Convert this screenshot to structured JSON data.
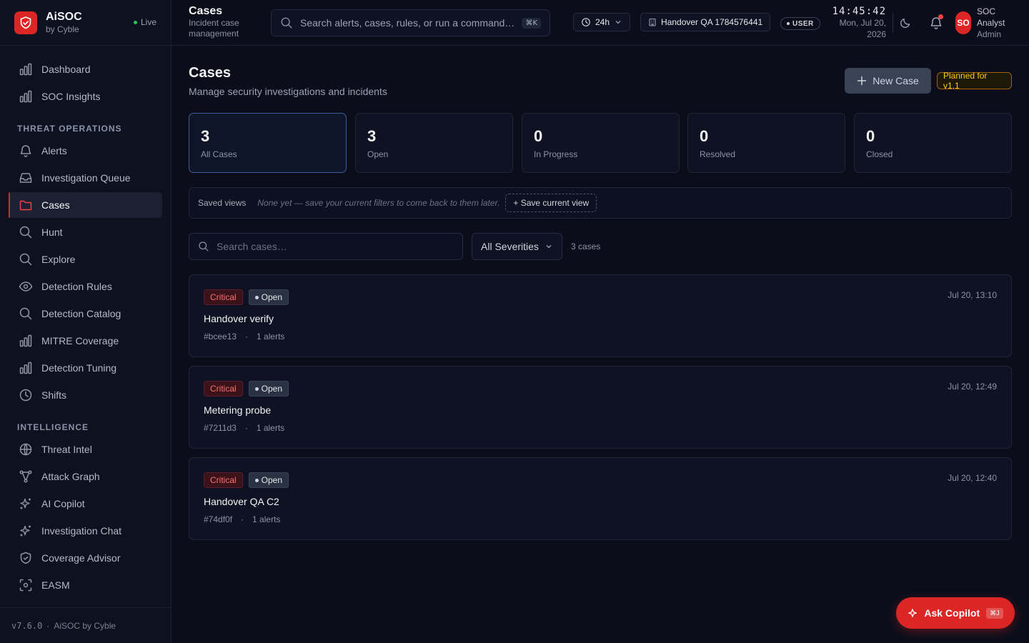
{
  "brand": {
    "name": "AiSOC",
    "sub": "by Cyble",
    "live": "Live"
  },
  "nav": {
    "top": [
      {
        "label": "Dashboard",
        "icon": "bar-chart-icon"
      },
      {
        "label": "SOC Insights",
        "icon": "bar-chart-icon"
      }
    ],
    "threat_ops_title": "THREAT OPERATIONS",
    "threat_ops": [
      {
        "label": "Alerts",
        "icon": "bell-icon"
      },
      {
        "label": "Investigation Queue",
        "icon": "inbox-icon"
      },
      {
        "label": "Cases",
        "icon": "folder-icon",
        "active": true
      },
      {
        "label": "Hunt",
        "icon": "search-icon"
      },
      {
        "label": "Explore",
        "icon": "search-icon"
      },
      {
        "label": "Detection Rules",
        "icon": "eye-icon"
      },
      {
        "label": "Detection Catalog",
        "icon": "search-icon"
      },
      {
        "label": "MITRE Coverage",
        "icon": "bar-chart-icon"
      },
      {
        "label": "Detection Tuning",
        "icon": "bar-chart-icon"
      },
      {
        "label": "Shifts",
        "icon": "clock-icon"
      }
    ],
    "intel_title": "INTELLIGENCE",
    "intel": [
      {
        "label": "Threat Intel",
        "icon": "globe-icon"
      },
      {
        "label": "Attack Graph",
        "icon": "graph-icon"
      },
      {
        "label": "AI Copilot",
        "icon": "sparkle-icon"
      },
      {
        "label": "Investigation Chat",
        "icon": "sparkle-icon"
      },
      {
        "label": "Coverage Advisor",
        "icon": "shield-icon"
      },
      {
        "label": "EASM",
        "icon": "scan-icon"
      }
    ]
  },
  "footer": {
    "version": "v7.6.0",
    "sep": "·",
    "by": "AiSOC by Cyble"
  },
  "header": {
    "title": "Cases",
    "subtitle": "Incident case management",
    "search_placeholder": "Search alerts, cases, rules, or run a command…",
    "search_kbd": "⌘K",
    "time_range": "24h",
    "tenant": "Handover QA 1784576441",
    "user_badge": "USER",
    "clock_time": "14:45:42",
    "clock_date": "Mon, Jul 20, 2026",
    "avatar": "SO",
    "user_name": "SOC Analyst",
    "user_role": "Admin"
  },
  "page": {
    "title": "Cases",
    "subtitle": "Manage security investigations and incidents",
    "new_case": "New Case",
    "planned": "Planned for v1.1"
  },
  "stats": [
    {
      "value": "3",
      "label": "All Cases",
      "active": true
    },
    {
      "value": "3",
      "label": "Open"
    },
    {
      "value": "0",
      "label": "In Progress"
    },
    {
      "value": "0",
      "label": "Resolved"
    },
    {
      "value": "0",
      "label": "Closed"
    }
  ],
  "saved_views": {
    "label": "Saved views",
    "hint": "None yet — save your current filters to come back to them later.",
    "button": "+ Save current view"
  },
  "filters": {
    "search_placeholder": "Search cases…",
    "severity": "All Severities",
    "count": "3 cases"
  },
  "cases": [
    {
      "severity": "Critical",
      "status": "Open",
      "title": "Handover verify",
      "id": "#bcee13",
      "dot": "·",
      "alerts": "1 alerts",
      "date": "Jul 20, 13:10"
    },
    {
      "severity": "Critical",
      "status": "Open",
      "title": "Metering probe",
      "id": "#7211d3",
      "dot": "·",
      "alerts": "1 alerts",
      "date": "Jul 20, 12:49"
    },
    {
      "severity": "Critical",
      "status": "Open",
      "title": "Handover QA C2",
      "id": "#74df0f",
      "dot": "·",
      "alerts": "1 alerts",
      "date": "Jul 20, 12:40"
    }
  ],
  "copilot": {
    "label": "Ask Copilot",
    "kbd": "⌘J"
  },
  "colors": {
    "accent": "#dc2626",
    "critical": "#f87171",
    "planned": "#facc15"
  }
}
